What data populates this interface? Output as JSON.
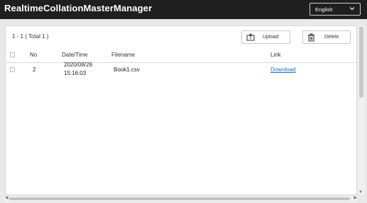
{
  "header": {
    "app_title": "RealtimeCollationMasterManager",
    "language": "English"
  },
  "toolbar": {
    "count_text": "1 - 1 ( Total 1 )",
    "upload_label": "Upload",
    "delete_label": "Delete"
  },
  "table": {
    "columns": {
      "no": "No",
      "datetime": "Date/Time",
      "filename": "Filename",
      "link": "Link"
    },
    "rows": [
      {
        "no": "2",
        "date": "2020/08/26",
        "time": "15:16:03",
        "filename": "Book1.csv",
        "link": "Download"
      }
    ]
  },
  "icons": {
    "upload": "upload-icon",
    "delete": "trash-icon",
    "dropdown": "chevron-down-icon"
  }
}
